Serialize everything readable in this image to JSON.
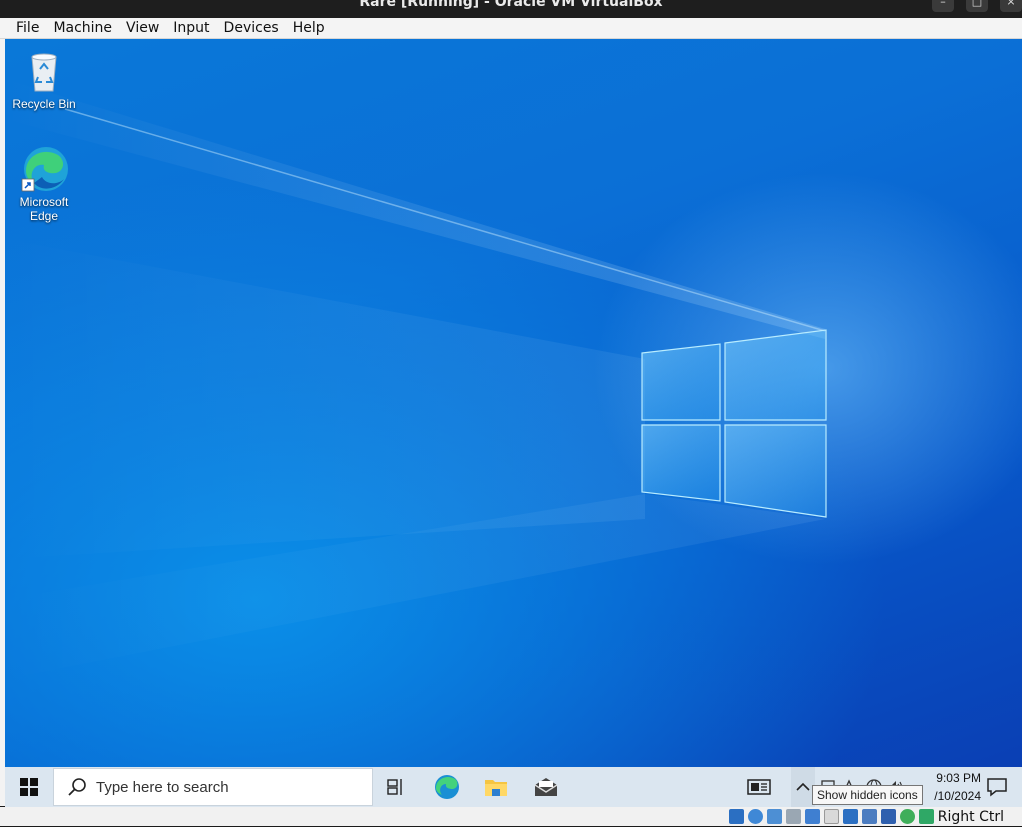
{
  "host_window": {
    "title": "Rare [Running] - Oracle VM VirtualBox",
    "controls": [
      "minimize-icon",
      "maximize-icon",
      "close-icon"
    ]
  },
  "menubar": {
    "items": [
      "File",
      "Machine",
      "View",
      "Input",
      "Devices",
      "Help"
    ]
  },
  "desktop": {
    "icons": [
      {
        "label": "Recycle Bin",
        "icon": "recycle-bin-icon"
      },
      {
        "label": "Microsoft Edge",
        "icon": "edge-icon"
      }
    ],
    "wallpaper": {
      "style": "Windows 10 hero",
      "accent": "#0a78d8"
    }
  },
  "taskbar": {
    "search": {
      "placeholder": "Type here to search"
    },
    "pinned": [
      "task-view-icon",
      "edge-icon",
      "file-explorer-icon",
      "mail-icon"
    ],
    "tray": {
      "chevron": "chevron-up-icon",
      "tooltip": "Show hidden icons",
      "icons": [
        "news-icon",
        "network-icon",
        "language-icon",
        "globe-icon",
        "volume-icon"
      ]
    },
    "clock": {
      "time": "9:03 PM",
      "date": "/10/2024"
    },
    "notification_icon": "notification-icon"
  },
  "vb_status": {
    "icons": [
      "hdd-icon",
      "optical-icon",
      "audio-icon",
      "network-icon",
      "usb-icon",
      "shared-folder-icon",
      "display-icon",
      "recording-icon",
      "cpu-icon",
      "mouse-integration-icon",
      "keyboard-icon"
    ],
    "host_key": "Right Ctrl"
  }
}
